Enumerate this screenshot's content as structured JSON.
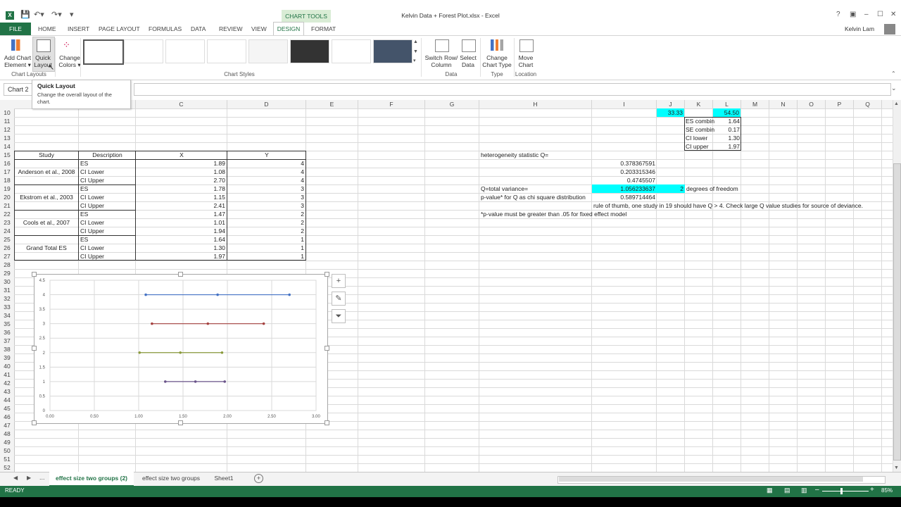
{
  "window": {
    "title": "Kelvin Data + Forest Plot.xlsx - Excel",
    "context_tab": "CHART TOOLS",
    "user": "Kelvin Lam",
    "help": "?"
  },
  "tabs": [
    "FILE",
    "HOME",
    "INSERT",
    "PAGE LAYOUT",
    "FORMULAS",
    "DATA",
    "REVIEW",
    "VIEW",
    "DESIGN",
    "FORMAT"
  ],
  "ribbon": {
    "add_chart_element": "Add Chart Element ▾",
    "quick_layout": "Quick Layout",
    "change_colors": "Change Colors ▾",
    "switch_row_column": "Switch Row/ Column",
    "select_data": "Select Data",
    "change_chart_type": "Change Chart Type",
    "move_chart": "Move Chart",
    "groups": {
      "chart_layouts": "Chart Layouts",
      "chart_styles": "Chart Styles",
      "data": "Data",
      "type": "Type",
      "location": "Location"
    }
  },
  "tooltip": {
    "title": "Quick Layout",
    "desc": "Change the overall layout of the chart."
  },
  "namebox": "Chart 2",
  "columns": [
    "C",
    "D",
    "E",
    "F",
    "G",
    "H",
    "I",
    "J",
    "K",
    "L",
    "M",
    "N",
    "O",
    "P",
    "Q"
  ],
  "rows": [
    "10",
    "11",
    "12",
    "13",
    "14",
    "15",
    "16",
    "17",
    "18",
    "19",
    "20",
    "21",
    "22",
    "23",
    "24",
    "25",
    "26",
    "27",
    "28",
    "29",
    "30",
    "31",
    "32",
    "33",
    "34",
    "35",
    "36",
    "37",
    "38",
    "39",
    "40",
    "41",
    "42",
    "43",
    "44",
    "45",
    "46",
    "47",
    "48",
    "49",
    "50",
    "51",
    "52"
  ],
  "table": {
    "headers": {
      "study": "Study",
      "description": "Description",
      "x": "X",
      "y": "Y"
    },
    "studies": [
      "Anderson et al., 2008",
      "Ekstrom et al., 2003",
      "Cools et al., 2007",
      "Grand Total ES"
    ],
    "desc": [
      "ES",
      "CI Lower",
      "CI Upper",
      "ES",
      "CI Lower",
      "CI Upper",
      "ES",
      "CI Lower",
      "CI Upper",
      "ES",
      "CI Lower",
      "CI Upper"
    ],
    "x": [
      "1.89",
      "1.08",
      "2.70",
      "1.78",
      "1.15",
      "2.41",
      "1.47",
      "1.01",
      "1.94",
      "1.64",
      "1.30",
      "1.97"
    ],
    "y": [
      "4",
      "4",
      "4",
      "3",
      "3",
      "3",
      "2",
      "2",
      "2",
      "1",
      "1",
      "1"
    ]
  },
  "right": {
    "j10": "33.33",
    "l10": "54.50",
    "k11": "ES combin",
    "l11": "1.64",
    "k12": "SE combin",
    "l12": "0.17",
    "k13": "CI lower",
    "l13": "1.30",
    "k14": "CI upper",
    "l14": "1.97",
    "h15": "heterogeneity statistic Q=",
    "i16": "0.378367591",
    "i17": "0.203315346",
    "i18": "0.4745507",
    "h19": "Q=total variance=",
    "i19": "1.056233637",
    "j19": "2",
    "k19": "degrees of freedom",
    "h20": "p-value* for Q as chi square distribution",
    "i20": "0.589714464",
    "i21": "rule of thumb, one study in 19 should have Q > 4. Check large Q value studies for source of deviance.",
    "h22": "*p-value must be greater than .05 for fixed effect model"
  },
  "chart_data": {
    "type": "scatter",
    "xlim": [
      0,
      3
    ],
    "ylim": [
      0,
      4.5
    ],
    "x_ticks": [
      "0.00",
      "0.50",
      "1.00",
      "1.50",
      "2.00",
      "2.50",
      "3.00"
    ],
    "y_ticks": [
      "0",
      "0.5",
      "1",
      "1.5",
      "2",
      "2.5",
      "3",
      "3.5",
      "4",
      "4.5"
    ],
    "series": [
      {
        "points": [
          [
            1.08,
            4
          ],
          [
            1.89,
            4
          ],
          [
            2.7,
            4
          ]
        ],
        "color": "#4472c4"
      },
      {
        "points": [
          [
            1.15,
            3
          ],
          [
            1.78,
            3
          ],
          [
            2.41,
            3
          ]
        ],
        "color": "#a5413f"
      },
      {
        "points": [
          [
            1.01,
            2
          ],
          [
            1.47,
            2
          ],
          [
            1.94,
            2
          ]
        ],
        "color": "#8a9a3c"
      },
      {
        "points": [
          [
            1.3,
            1
          ],
          [
            1.64,
            1
          ],
          [
            1.97,
            1
          ]
        ],
        "color": "#6a548a"
      }
    ]
  },
  "sheets": [
    "effect size two groups (2)",
    "effect size two groups",
    "Sheet1"
  ],
  "status": {
    "ready": "READY",
    "zoom": "85%"
  },
  "colors": {
    "excel_green": "#217346",
    "highlight": "#00ffff"
  }
}
